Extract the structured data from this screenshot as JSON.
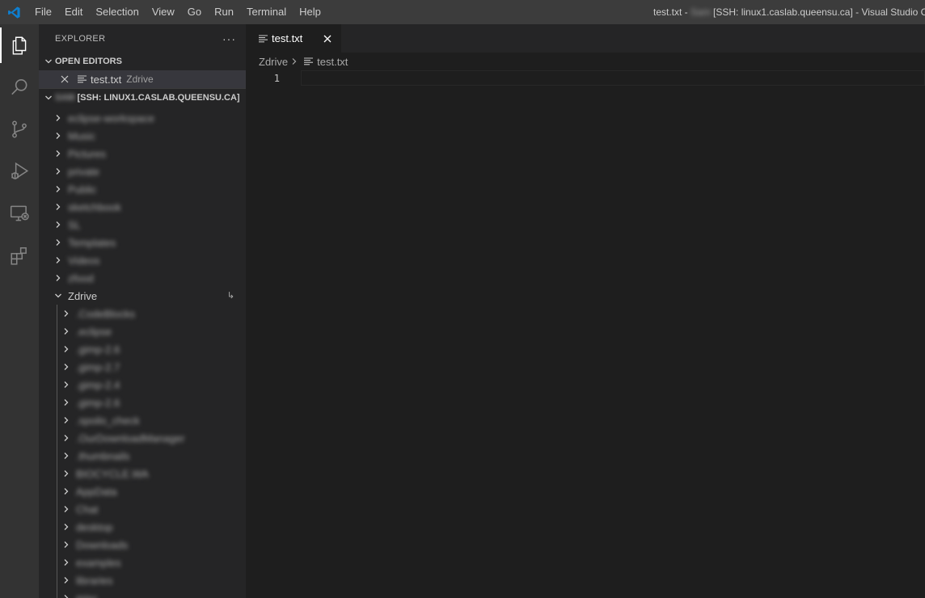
{
  "titlebar": {
    "menu": [
      "File",
      "Edit",
      "Selection",
      "View",
      "Go",
      "Run",
      "Terminal",
      "Help"
    ],
    "title_file": "test.txt - ",
    "title_user": "Sam",
    "title_rest": "[SSH: linux1.caslab.queensu.ca] - Visual Studio Co"
  },
  "activitybar": {
    "icons": [
      "files-icon",
      "search-icon",
      "source-control-icon",
      "run-debug-icon",
      "remote-explorer-icon",
      "extensions-icon"
    ]
  },
  "sidebar": {
    "title": "EXPLORER",
    "more": "···",
    "open_editors": {
      "header": "OPEN EDITORS",
      "item_name": "test.txt",
      "item_desc": "Zdrive"
    },
    "workspace": {
      "header_user": "SAM",
      "header_rest": "[SSH: LINUX1.CASLAB.QUEENSU.CA]",
      "folders": [
        "eclipse-workspace",
        "Music",
        "Pictures",
        "private",
        "Public",
        "sketchbook",
        "SL",
        "Templates",
        "Videos",
        "zfood"
      ],
      "zdrive": {
        "name": "Zdrive",
        "children": [
          ".CodeBlocks",
          ".eclipse",
          ".gimp-2.6",
          ".gimp-2.7",
          ".gimp-2.4",
          ".gimp-2.6",
          ".spoilo_check",
          ".OurDownloadManager",
          ".thumbnails",
          "BIOCYCLE.WA",
          "AppData",
          "Chat",
          "desktop",
          "Downloads",
          "examples",
          "libraries",
          "misc"
        ]
      }
    }
  },
  "editor": {
    "tab_label": "test.txt",
    "breadcrumb_folder": "Zdrive",
    "breadcrumb_file": "test.txt",
    "line_number": "1"
  },
  "colors": {
    "titlebar": "#3c3c3c",
    "activitybar": "#333333",
    "sidebar": "#252526",
    "editor": "#1e1e1e",
    "accent": "#007acc"
  }
}
